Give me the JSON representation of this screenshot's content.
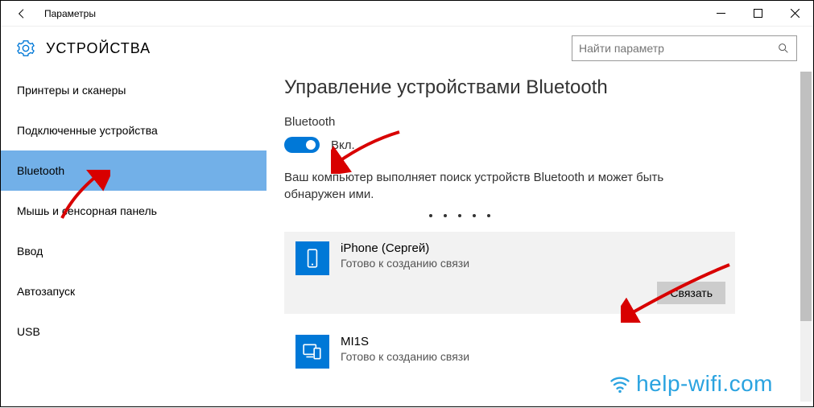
{
  "titlebar": {
    "title": "Параметры"
  },
  "header": {
    "section": "УСТРОЙСТВА",
    "search_placeholder": "Найти параметр"
  },
  "sidebar": {
    "items": [
      {
        "label": "Принтеры и сканеры"
      },
      {
        "label": "Подключенные устройства"
      },
      {
        "label": "Bluetooth",
        "selected": true
      },
      {
        "label": "Мышь и сенсорная панель"
      },
      {
        "label": "Ввод"
      },
      {
        "label": "Автозапуск"
      },
      {
        "label": "USB"
      }
    ]
  },
  "content": {
    "heading": "Управление устройствами Bluetooth",
    "toggle_section_label": "Bluetooth",
    "toggle_state_label": "Вкл.",
    "status_text": "Ваш компьютер выполняет поиск устройств Bluetooth и может быть обнаружен ими.",
    "pair_button": "Связать",
    "devices": [
      {
        "name": "iPhone (Сергей)",
        "sub": "Готово к созданию связи",
        "selected": true,
        "icon": "phone"
      },
      {
        "name": "MI1S",
        "sub": "Готово к созданию связи",
        "selected": false,
        "icon": "monitor-phone"
      }
    ]
  },
  "watermark": "help-wifi.com"
}
